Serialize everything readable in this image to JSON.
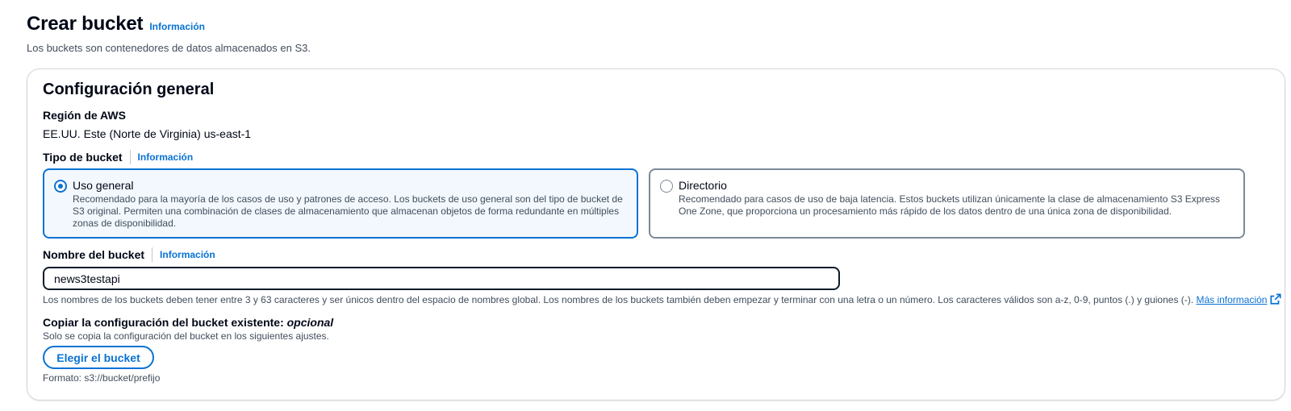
{
  "header": {
    "title": "Crear bucket",
    "info_link": "Información",
    "description": "Los buckets son contenedores de datos almacenados en S3."
  },
  "general_config": {
    "section_title": "Configuración general",
    "region": {
      "label": "Región de AWS",
      "value": "EE.UU. Este (Norte de Virginia) us-east-1"
    },
    "bucket_type": {
      "label": "Tipo de bucket",
      "info_link": "Información",
      "options": [
        {
          "title": "Uso general",
          "description": "Recomendado para la mayoría de los casos de uso y patrones de acceso. Los buckets de uso general son del tipo de bucket de S3 original. Permiten una combinación de clases de almacenamiento que almacenan objetos de forma redundante en múltiples zonas de disponibilidad.",
          "selected": true
        },
        {
          "title": "Directorio",
          "description": "Recomendado para casos de uso de baja latencia. Estos buckets utilizan únicamente la clase de almacenamiento S3 Express One Zone, que proporciona un procesamiento más rápido de los datos dentro de una única zona de disponibilidad.",
          "selected": false
        }
      ]
    },
    "bucket_name": {
      "label": "Nombre del bucket",
      "info_link": "Información",
      "value": "news3testapi",
      "constraint_text": "Los nombres de los buckets deben tener entre 3 y 63 caracteres y ser únicos dentro del espacio de nombres global. Los nombres de los buckets también deben empezar y terminar con una letra o un número. Los caracteres válidos son a-z, 0-9, puntos (.) y guiones (-).",
      "more_info_link": "Más información"
    },
    "copy_config": {
      "label": "Copiar la configuración del bucket existente:",
      "optional": "opcional",
      "description": "Solo se copia la configuración del bucket en los siguientes ajustes.",
      "button_label": "Elegir el bucket",
      "format_hint": "Formato: s3://bucket/prefijo"
    }
  },
  "colors": {
    "link": "#0972d3",
    "selected_bg": "#f2f8fd",
    "text": "#000716",
    "secondary_text": "#414d5c"
  }
}
